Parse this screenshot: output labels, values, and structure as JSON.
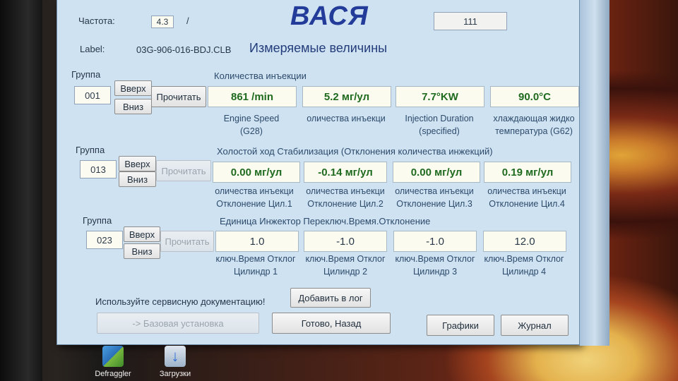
{
  "app": {
    "title": "ВАСЯ",
    "screen_title": "Измеряемые величины"
  },
  "header": {
    "freq_label": "Частота:",
    "freq_value": "4.3",
    "freq_sep": "/",
    "top_box_value": "111",
    "label_caption": "Label:",
    "label_value": "03G-906-016-BDJ.CLB"
  },
  "groups": [
    {
      "group_label": "Группа",
      "number": "001",
      "title": "Количества инъекции",
      "up": "Вверх",
      "down": "Вниз",
      "read": "Прочитать",
      "read_enabled": true,
      "values": [
        "861 /min",
        "5.2 мг/ул",
        "7.7°KW",
        "90.0°C"
      ],
      "captions": [
        [
          "Engine Speed",
          "(G28)"
        ],
        [
          "оличества инъекци",
          ""
        ],
        [
          "Injection Duration",
          "(specified)"
        ],
        [
          "хлаждающая жидко",
          "температура (G62)"
        ]
      ]
    },
    {
      "group_label": "Группа",
      "number": "013",
      "title": "Холостой ход Стабилизация (Отклонения количества инжекций)",
      "up": "Вверх",
      "down": "Вниз",
      "read": "Прочитать",
      "read_enabled": false,
      "values": [
        "0.00 мг/ул",
        "-0.14 мг/ул",
        "0.00 мг/ул",
        "0.19 мг/ул"
      ],
      "captions": [
        [
          "оличества инъекци",
          "Отклонение Цил.1"
        ],
        [
          "оличества инъекци",
          "Отклонение Цил.2"
        ],
        [
          "оличества инъекци",
          "Отклонение Цил.3"
        ],
        [
          "оличества инъекци",
          "Отклонение Цил.4"
        ]
      ]
    },
    {
      "group_label": "Группа",
      "number": "023",
      "title": "Единица Инжектор Переключ.Время.Отклонение",
      "up": "Вверх",
      "down": "Вниз",
      "read": "Прочитать",
      "read_enabled": false,
      "values": [
        "1.0",
        "-1.0",
        "-1.0",
        "12.0"
      ],
      "captions": [
        [
          "ключ.Время Отклог",
          "Цилиндр 1"
        ],
        [
          "ключ.Время Отклог",
          "Цилиндр 2"
        ],
        [
          "ключ.Время Отклог",
          "Цилиндр 3"
        ],
        [
          "ключ.Время Отклог",
          "Цилиндр 4"
        ]
      ]
    }
  ],
  "footer": {
    "service_note": "Используйте сервисную документацию!",
    "add_log": "Добавить в лог",
    "basic_setting": "-> Базовая установка",
    "done_back": "Готово, Назад",
    "graphs": "Графики",
    "journal": "Журнал"
  },
  "desktop": {
    "icons": [
      "Defraggler",
      "Загрузки"
    ]
  }
}
